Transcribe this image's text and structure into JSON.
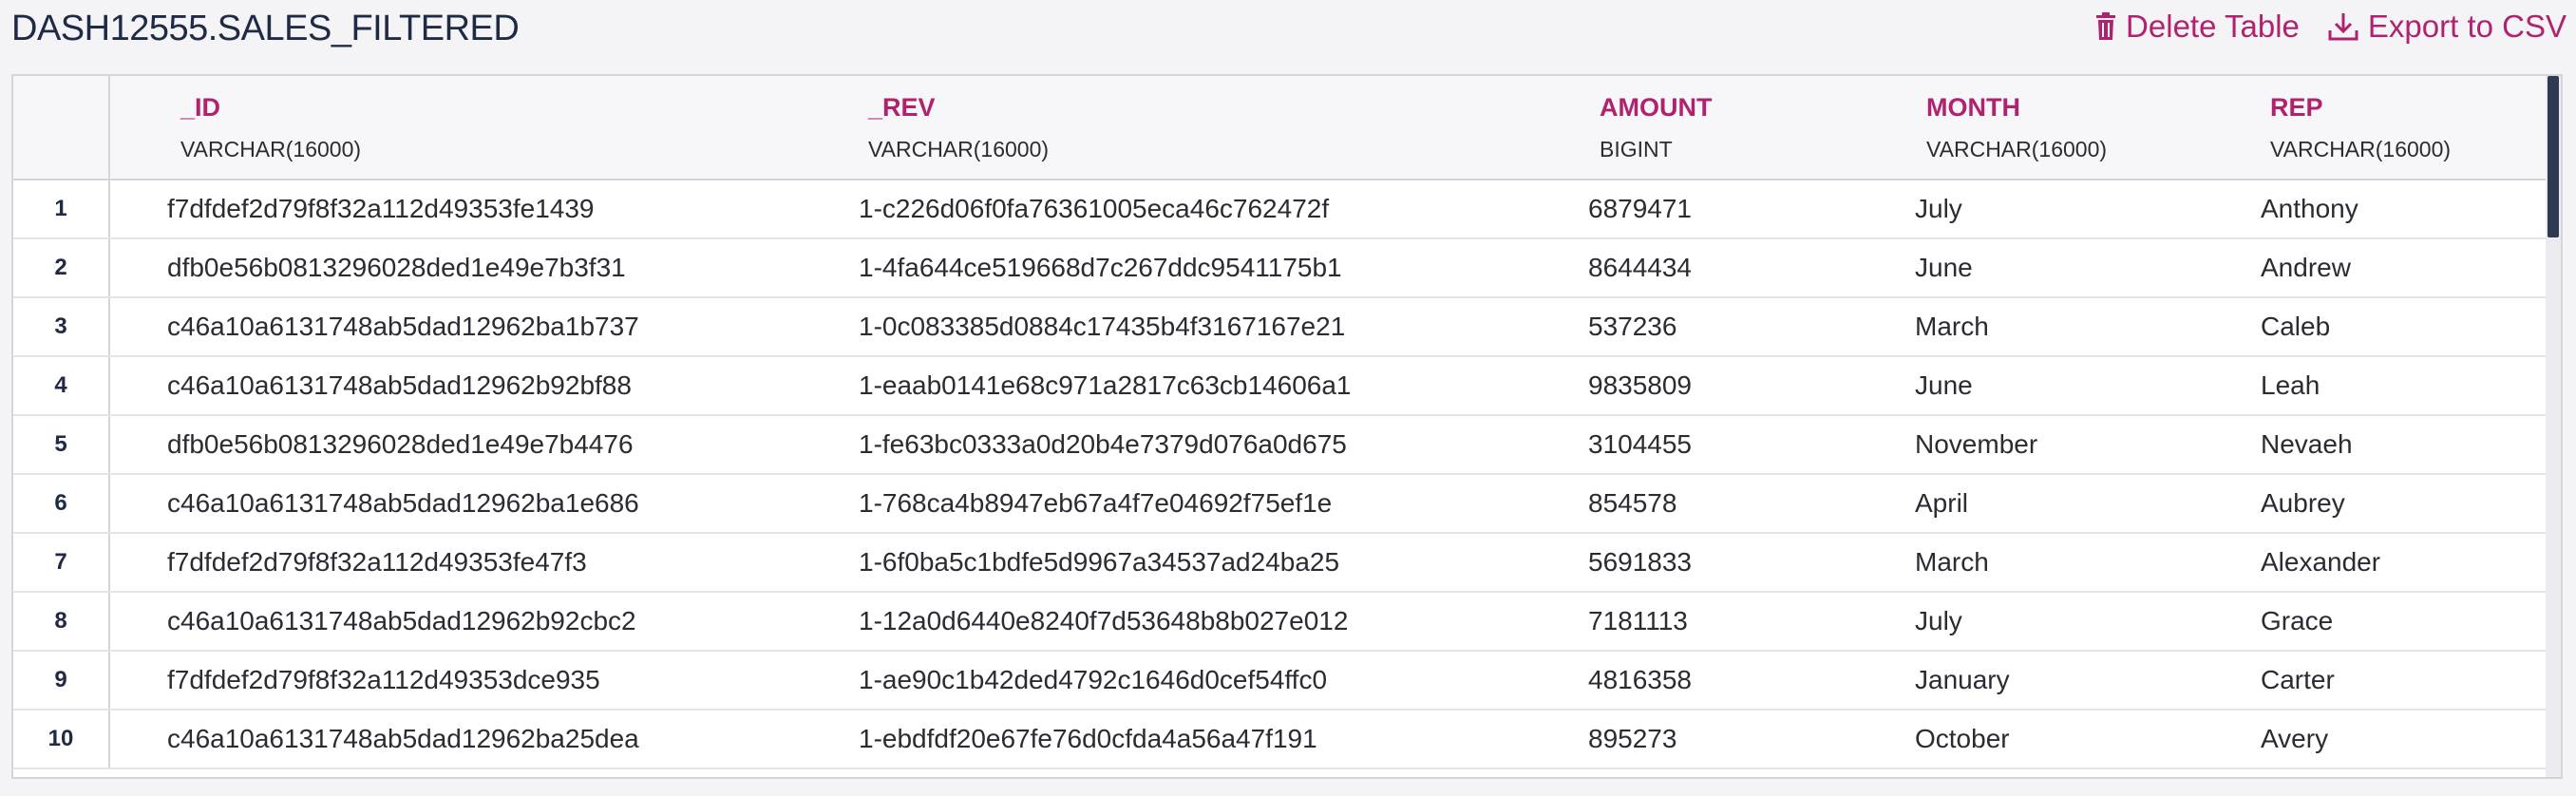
{
  "header": {
    "title": "DASH12555.SALES_FILTERED",
    "delete_label": "Delete Table",
    "export_label": "Export to CSV"
  },
  "colors": {
    "accent": "#b0226f",
    "title": "#1f2a44",
    "scroll_thumb": "#2e3a52"
  },
  "icons": {
    "delete": "trash-icon",
    "export": "download-icon"
  },
  "table": {
    "columns": [
      {
        "name": "_ID",
        "type": "VARCHAR(16000)"
      },
      {
        "name": "_REV",
        "type": "VARCHAR(16000)"
      },
      {
        "name": "AMOUNT",
        "type": "BIGINT"
      },
      {
        "name": "MONTH",
        "type": "VARCHAR(16000)"
      },
      {
        "name": "REP",
        "type": "VARCHAR(16000)"
      }
    ],
    "rows": [
      {
        "num": "1",
        "id": "f7dfdef2d79f8f32a112d49353fe1439",
        "rev": "1-c226d06f0fa76361005eca46c762472f",
        "amount": "6879471",
        "month": "July",
        "rep": "Anthony"
      },
      {
        "num": "2",
        "id": "dfb0e56b0813296028ded1e49e7b3f31",
        "rev": "1-4fa644ce519668d7c267ddc9541175b1",
        "amount": "8644434",
        "month": "June",
        "rep": "Andrew"
      },
      {
        "num": "3",
        "id": "c46a10a6131748ab5dad12962ba1b737",
        "rev": "1-0c083385d0884c17435b4f3167167e21",
        "amount": "537236",
        "month": "March",
        "rep": "Caleb"
      },
      {
        "num": "4",
        "id": "c46a10a6131748ab5dad12962b92bf88",
        "rev": "1-eaab0141e68c971a2817c63cb14606a1",
        "amount": "9835809",
        "month": "June",
        "rep": "Leah"
      },
      {
        "num": "5",
        "id": "dfb0e56b0813296028ded1e49e7b4476",
        "rev": "1-fe63bc0333a0d20b4e7379d076a0d675",
        "amount": "3104455",
        "month": "November",
        "rep": "Nevaeh"
      },
      {
        "num": "6",
        "id": "c46a10a6131748ab5dad12962ba1e686",
        "rev": "1-768ca4b8947eb67a4f7e04692f75ef1e",
        "amount": "854578",
        "month": "April",
        "rep": "Aubrey"
      },
      {
        "num": "7",
        "id": "f7dfdef2d79f8f32a112d49353fe47f3",
        "rev": "1-6f0ba5c1bdfe5d9967a34537ad24ba25",
        "amount": "5691833",
        "month": "March",
        "rep": "Alexander"
      },
      {
        "num": "8",
        "id": "c46a10a6131748ab5dad12962b92cbc2",
        "rev": "1-12a0d6440e8240f7d53648b8b027e012",
        "amount": "7181113",
        "month": "July",
        "rep": "Grace"
      },
      {
        "num": "9",
        "id": "f7dfdef2d79f8f32a112d49353dce935",
        "rev": "1-ae90c1b42ded4792c1646d0cef54ffc0",
        "amount": "4816358",
        "month": "January",
        "rep": "Carter"
      },
      {
        "num": "10",
        "id": "c46a10a6131748ab5dad12962ba25dea",
        "rev": "1-ebdfdf20e67fe76d0cfda4a56a47f191",
        "amount": "895273",
        "month": "October",
        "rep": "Avery"
      }
    ]
  }
}
